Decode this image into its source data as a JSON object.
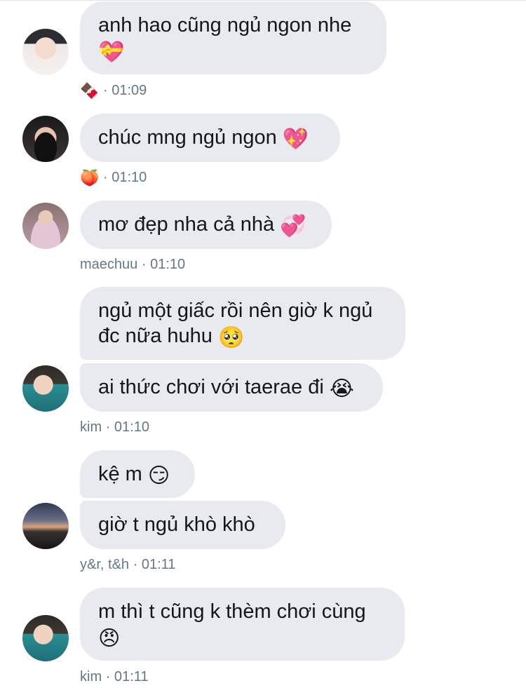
{
  "messages": [
    {
      "text": "anh hao cũng ngủ ngon nhe",
      "emoji": "💝"
    },
    {
      "text": "chúc mng ngủ ngon",
      "emoji": "💖"
    },
    {
      "text": "mơ đẹp nha cả nhà",
      "emoji": "💞"
    },
    {
      "text": "ngủ một giấc rồi nên giờ k ngủ",
      "text2": "đc nữa huhu",
      "emoji": "🥺"
    },
    {
      "text": "ai thức chơi với taerae đi",
      "emoji": "😭"
    },
    {
      "text": "kệ m",
      "emoji": "😏"
    },
    {
      "text": "giờ t ngủ khò khò"
    },
    {
      "text": "m thì t cũng k thèm chơi cùng",
      "emoji": "😠"
    }
  ],
  "meta": [
    {
      "emoji": "🍫",
      "sep": "·",
      "time": "01:09"
    },
    {
      "emoji": "🍑",
      "sep": "·",
      "time": "01:10"
    },
    {
      "sender": "maechuu",
      "sep": "·",
      "time": "01:10"
    },
    {
      "sender": "kim",
      "sep": "·",
      "time": "01:10"
    },
    {
      "sender": "y&r, t&h",
      "sep": "·",
      "time": "01:11"
    },
    {
      "sender": "kim",
      "sep": "·",
      "time": "01:11"
    }
  ],
  "colors": {
    "bubble": "#e8eaef",
    "text": "#14171a",
    "meta": "#657786"
  }
}
